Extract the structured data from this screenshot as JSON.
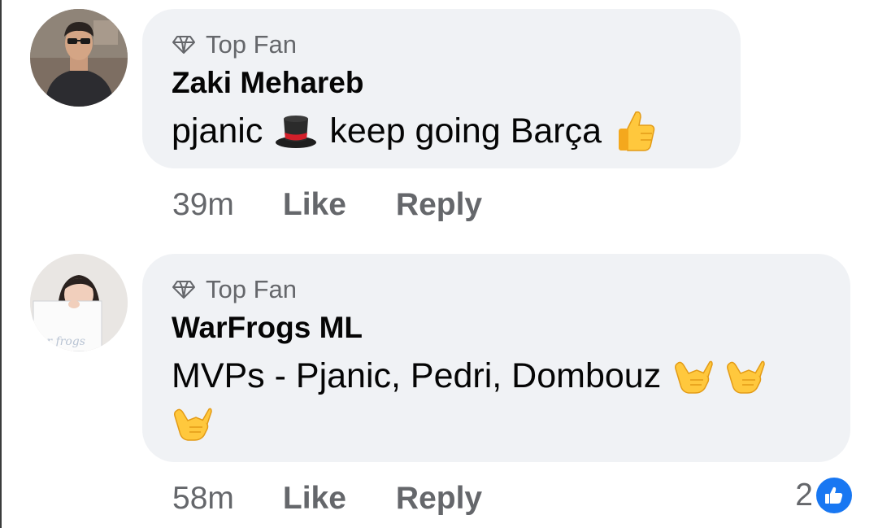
{
  "comments": [
    {
      "badge_label": "Top Fan",
      "author": "Zaki Mehareb",
      "text_parts": [
        "pjanic",
        "keep going Barça"
      ],
      "emojis": [
        "top-hat-emoji",
        "thumbs-up-emoji"
      ],
      "time": "39m",
      "like_label": "Like",
      "reply_label": "Reply"
    },
    {
      "badge_label": "Top Fan",
      "author": "WarFrogs ML",
      "text_line1": "MVPs - Pjanic, Pedri, Dombouz",
      "emojis": [
        "call-me-hand-emoji",
        "call-me-hand-emoji",
        "call-me-hand-emoji"
      ],
      "time": "58m",
      "like_label": "Like",
      "reply_label": "Reply",
      "reaction_count": "2",
      "reaction_icon": "like-thumb-icon"
    }
  ],
  "colors": {
    "bubble": "#f0f2f5",
    "secondary_text": "#65676b",
    "primary_text": "#050505",
    "like_blue": "#1877f2"
  }
}
